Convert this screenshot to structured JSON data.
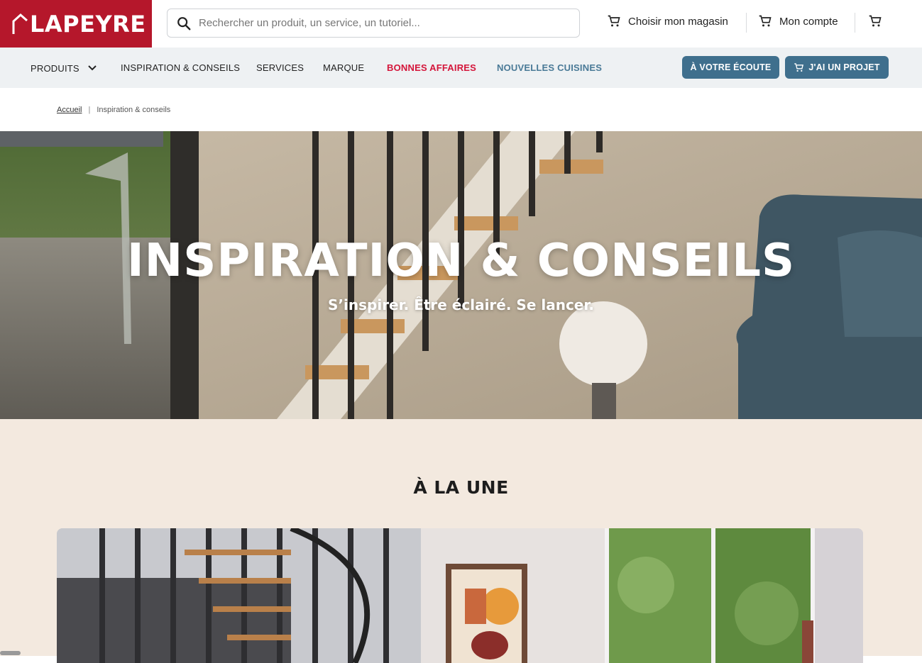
{
  "brand": {
    "name": "LAPEYRE",
    "color": "#b5172b"
  },
  "search": {
    "placeholder": "Rechercher un produit, un service, un tutoriel..."
  },
  "header_links": {
    "store": "Choisir mon magasin",
    "account": "Mon compte"
  },
  "nav": {
    "items": [
      {
        "label": "PRODUITS"
      },
      {
        "label": "INSPIRATION & CONSEILS"
      },
      {
        "label": "SERVICES"
      },
      {
        "label": "MARQUE"
      },
      {
        "label": "BONNES AFFAIRES"
      },
      {
        "label": "NOUVELLES CUISINES"
      }
    ],
    "listen_button": "À VOTRE ÉCOUTE",
    "project_button": "J'AI UN PROJET"
  },
  "breadcrumb": {
    "home": "Accueil",
    "current": "Inspiration & conseils"
  },
  "hero": {
    "title": "INSPIRATION & CONSEILS",
    "subtitle": "S’inspirer. Être éclairé. Se lancer."
  },
  "section": {
    "title": "À LA UNE"
  },
  "colors": {
    "accent_red": "#d4153a",
    "accent_blue": "#3f6f8d",
    "nav_bg": "#eef1f3",
    "section_bg": "#f3e9df"
  }
}
